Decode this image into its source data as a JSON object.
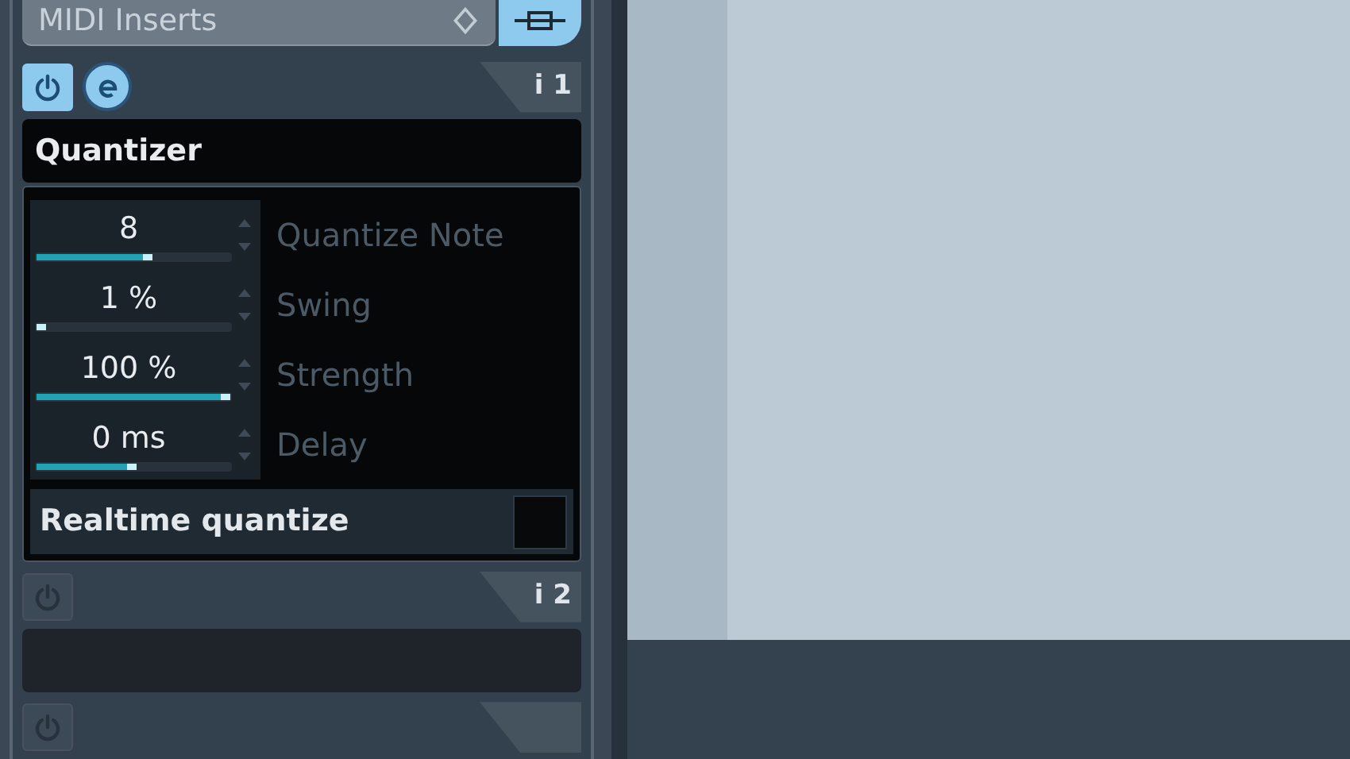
{
  "section": {
    "title": "MIDI Inserts"
  },
  "slots": [
    {
      "label": "i 1",
      "on": true,
      "edit": true,
      "plugin": "Quantizer",
      "params": [
        {
          "value": "8",
          "level": 0.6,
          "name": "Quantize Note"
        },
        {
          "value": "1 %",
          "level": 0.03,
          "name": "Swing"
        },
        {
          "value": "100 %",
          "level": 1.0,
          "name": "Strength"
        },
        {
          "value": "0 ms",
          "level": 0.52,
          "name": "Delay"
        }
      ],
      "option": {
        "label": "Realtime quantize",
        "checked": false
      }
    },
    {
      "label": "i 2",
      "on": false
    },
    {
      "on": false
    }
  ]
}
